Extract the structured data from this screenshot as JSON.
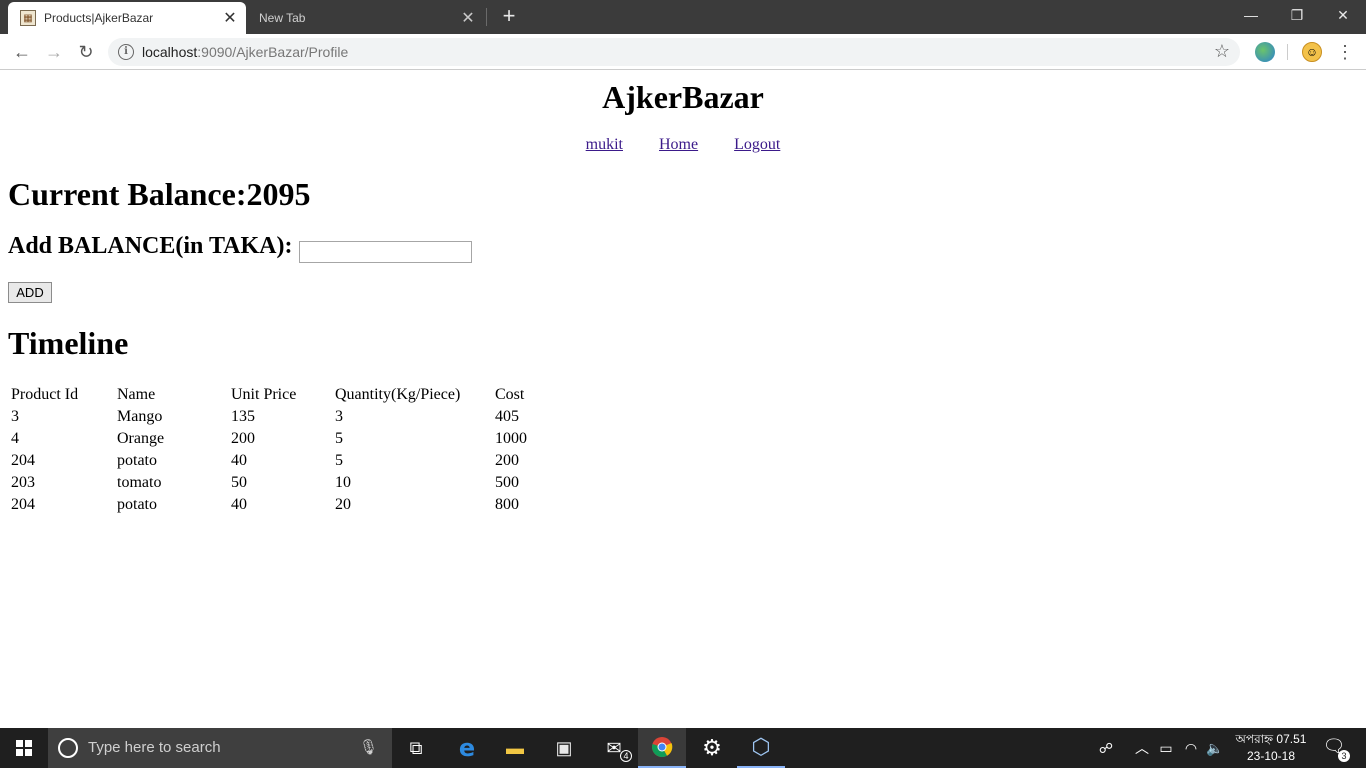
{
  "browser": {
    "tabs": [
      {
        "title": "Products|AjkerBazar",
        "close": "✕"
      },
      {
        "title": "New Tab",
        "close": "✕"
      }
    ],
    "new_tab": "+",
    "window_controls": {
      "minimize": "—",
      "restore": "❐",
      "close": "✕"
    },
    "nav": {
      "back": "←",
      "forward": "→",
      "reload": "↻"
    },
    "url_host": "localhost",
    "url_rest": ":9090/AjkerBazar/Profile",
    "star": "☆",
    "menu": "⋮"
  },
  "page": {
    "site_title": "AjkerBazar",
    "nav_links": [
      "mukit",
      "Home",
      "Logout"
    ],
    "balance_label": "Current Balance:2095",
    "add_balance_label": "Add BALANCE(in TAKA):",
    "add_balance_value": "",
    "add_button": "ADD",
    "timeline_title": "Timeline",
    "table": {
      "headers": [
        "Product Id",
        "Name",
        "Unit Price",
        "Quantity(Kg/Piece)",
        "Cost"
      ],
      "rows": [
        [
          "3",
          "Mango",
          "135",
          "3",
          "405"
        ],
        [
          "4",
          "Orange",
          "200",
          "5",
          "1000"
        ],
        [
          "204",
          "potato",
          "40",
          "5",
          "200"
        ],
        [
          "203",
          "tomato",
          "50",
          "10",
          "500"
        ],
        [
          "204",
          "potato",
          "40",
          "20",
          "800"
        ]
      ]
    }
  },
  "taskbar": {
    "search_placeholder": "Type here to search",
    "mail_badge": "4",
    "clock_time": "অপরাহ্ন 07.51",
    "clock_date": "23-10-18",
    "notification_count": "3",
    "apps": [
      "task-view",
      "edge",
      "file-explorer",
      "store",
      "mail",
      "chrome",
      "settings",
      "virtualbox"
    ]
  },
  "colors": {
    "link": "#3b1a8a",
    "taskbar": "#1f1f1f",
    "tabstrip": "#3b3b3b"
  }
}
